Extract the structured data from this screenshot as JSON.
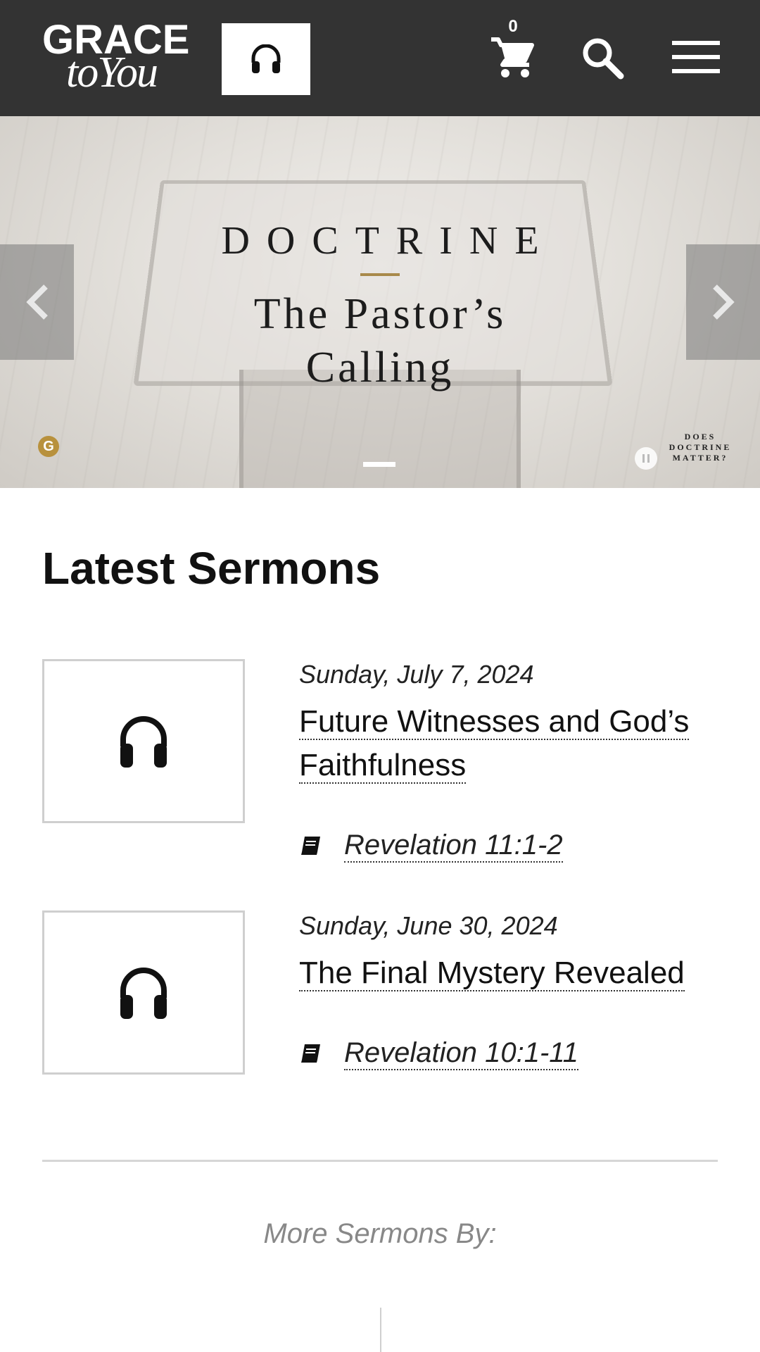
{
  "header": {
    "logo_line1": "GRACE",
    "logo_line2": "toYou",
    "cart_count": "0",
    "icons": {
      "listen": "headphones-icon",
      "cart": "cart-icon",
      "search": "search-icon",
      "menu": "hamburger-menu-icon"
    },
    "background_color": "#333333"
  },
  "hero": {
    "title": "DOCTRINE",
    "subtitle_line1": "The Pastor’s",
    "subtitle_line2": "Calling",
    "badge_letter": "G",
    "corner_text_line1": "DOES",
    "corner_text_line2": "DOCTRINE",
    "corner_text_line3": "MATTER?",
    "accent_color": "#a8894a",
    "slides_total": 1,
    "active_slide": 1
  },
  "latest": {
    "heading": "Latest Sermons",
    "sermons": [
      {
        "date": "Sunday, July 7, 2024",
        "title": "Future Witnesses and God’s Faithfulness",
        "scripture": "Revelation 11:1-2"
      },
      {
        "date": "Sunday, June 30, 2024",
        "title": "The Final Mystery Revealed",
        "scripture": "Revelation 10:1-11"
      }
    ]
  },
  "more": {
    "label": "More Sermons By:"
  }
}
